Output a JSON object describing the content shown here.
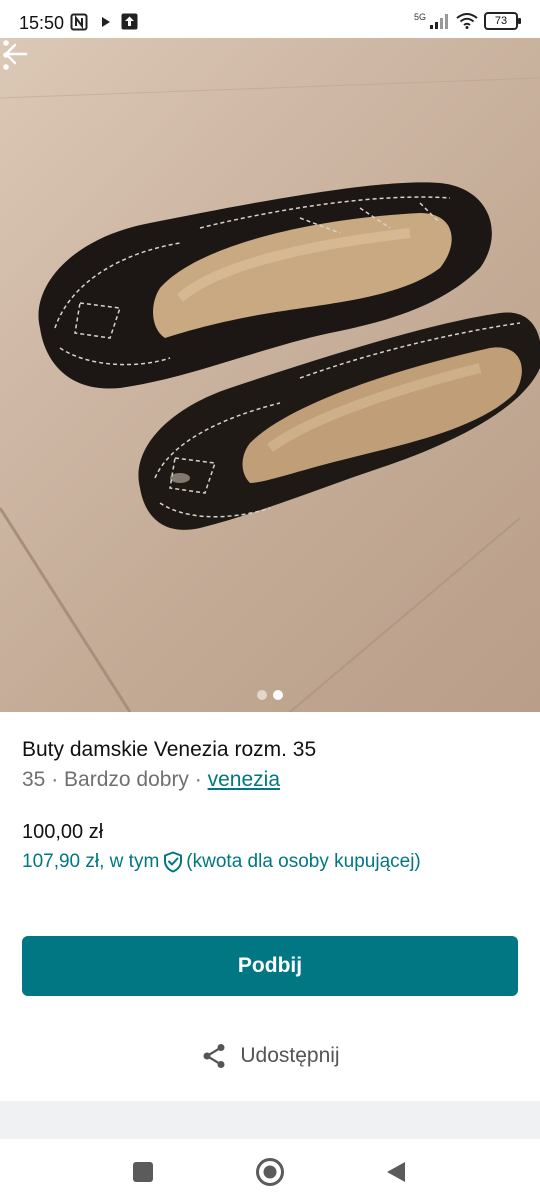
{
  "status_bar": {
    "time": "15:50",
    "network": "5G",
    "battery": "73",
    "icons": [
      "nfc-icon",
      "play-icon",
      "upload-icon",
      "signal-icon",
      "wifi-icon",
      "battery-icon"
    ]
  },
  "photo": {
    "icons": [
      "back-arrow-icon",
      "more-vertical-icon"
    ],
    "page_count": 2,
    "active_page": 2
  },
  "listing": {
    "title": "Buty damskie Venezia rozm. 35",
    "size": "35",
    "separator": " · ",
    "condition": "Bardzo dobry",
    "brand": "venezia",
    "price": "100,00 zł",
    "total_price": "107,90 zł",
    "total_suffix": ", w tym",
    "protection_note": "(kwota dla osoby kupującej)"
  },
  "actions": {
    "primary_label": "Podbij",
    "share_label": "Udostępnij"
  },
  "colors": {
    "accent": "#007782",
    "text": "#111111",
    "muted": "#707070",
    "strip": "#eff1f2"
  },
  "nav_bar": {
    "icons": [
      "recents-square-icon",
      "home-circle-icon",
      "back-triangle-icon"
    ]
  }
}
